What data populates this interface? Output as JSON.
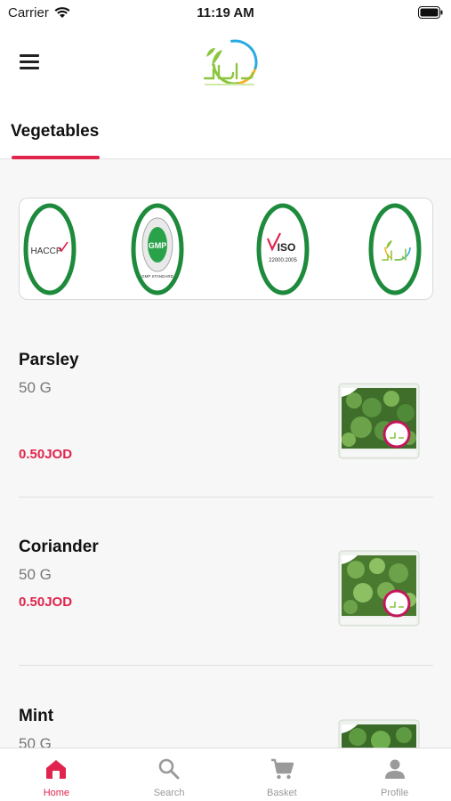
{
  "status_bar": {
    "carrier": "Carrier",
    "time": "11:19 AM"
  },
  "header": {
    "logo_icon": "ishtal-leaf-logo",
    "menu_icon": "hamburger-menu-icon"
  },
  "tabs": [
    {
      "label": "Vegetables",
      "active": true
    }
  ],
  "certifications": [
    {
      "icon": "haccp-badge-icon",
      "label": "HACCP"
    },
    {
      "icon": "gmp-badge-icon",
      "label": "GMP",
      "sub": "GMP STANDARD"
    },
    {
      "icon": "iso-badge-icon",
      "label": "ISO",
      "sub": "22000:2005"
    },
    {
      "icon": "ishtal-badge-icon"
    }
  ],
  "products": [
    {
      "name": "Parsley",
      "weight": "50 G",
      "price": "0.50JOD"
    },
    {
      "name": "Coriander",
      "weight": "50 G",
      "price": "0.50JOD"
    },
    {
      "name": "Mint",
      "weight": "50 G",
      "price": ""
    }
  ],
  "bottom_nav": [
    {
      "label": "Home",
      "icon": "home-icon",
      "active": true
    },
    {
      "label": "Search",
      "icon": "search-icon",
      "active": false
    },
    {
      "label": "Basket",
      "icon": "cart-icon",
      "active": false
    },
    {
      "label": "Profile",
      "icon": "user-icon",
      "active": false
    }
  ],
  "colors": {
    "accent": "#e0244d",
    "cert_green": "#1e8a3c",
    "logo_green": "#8cc63f",
    "logo_blue": "#29abe2"
  }
}
